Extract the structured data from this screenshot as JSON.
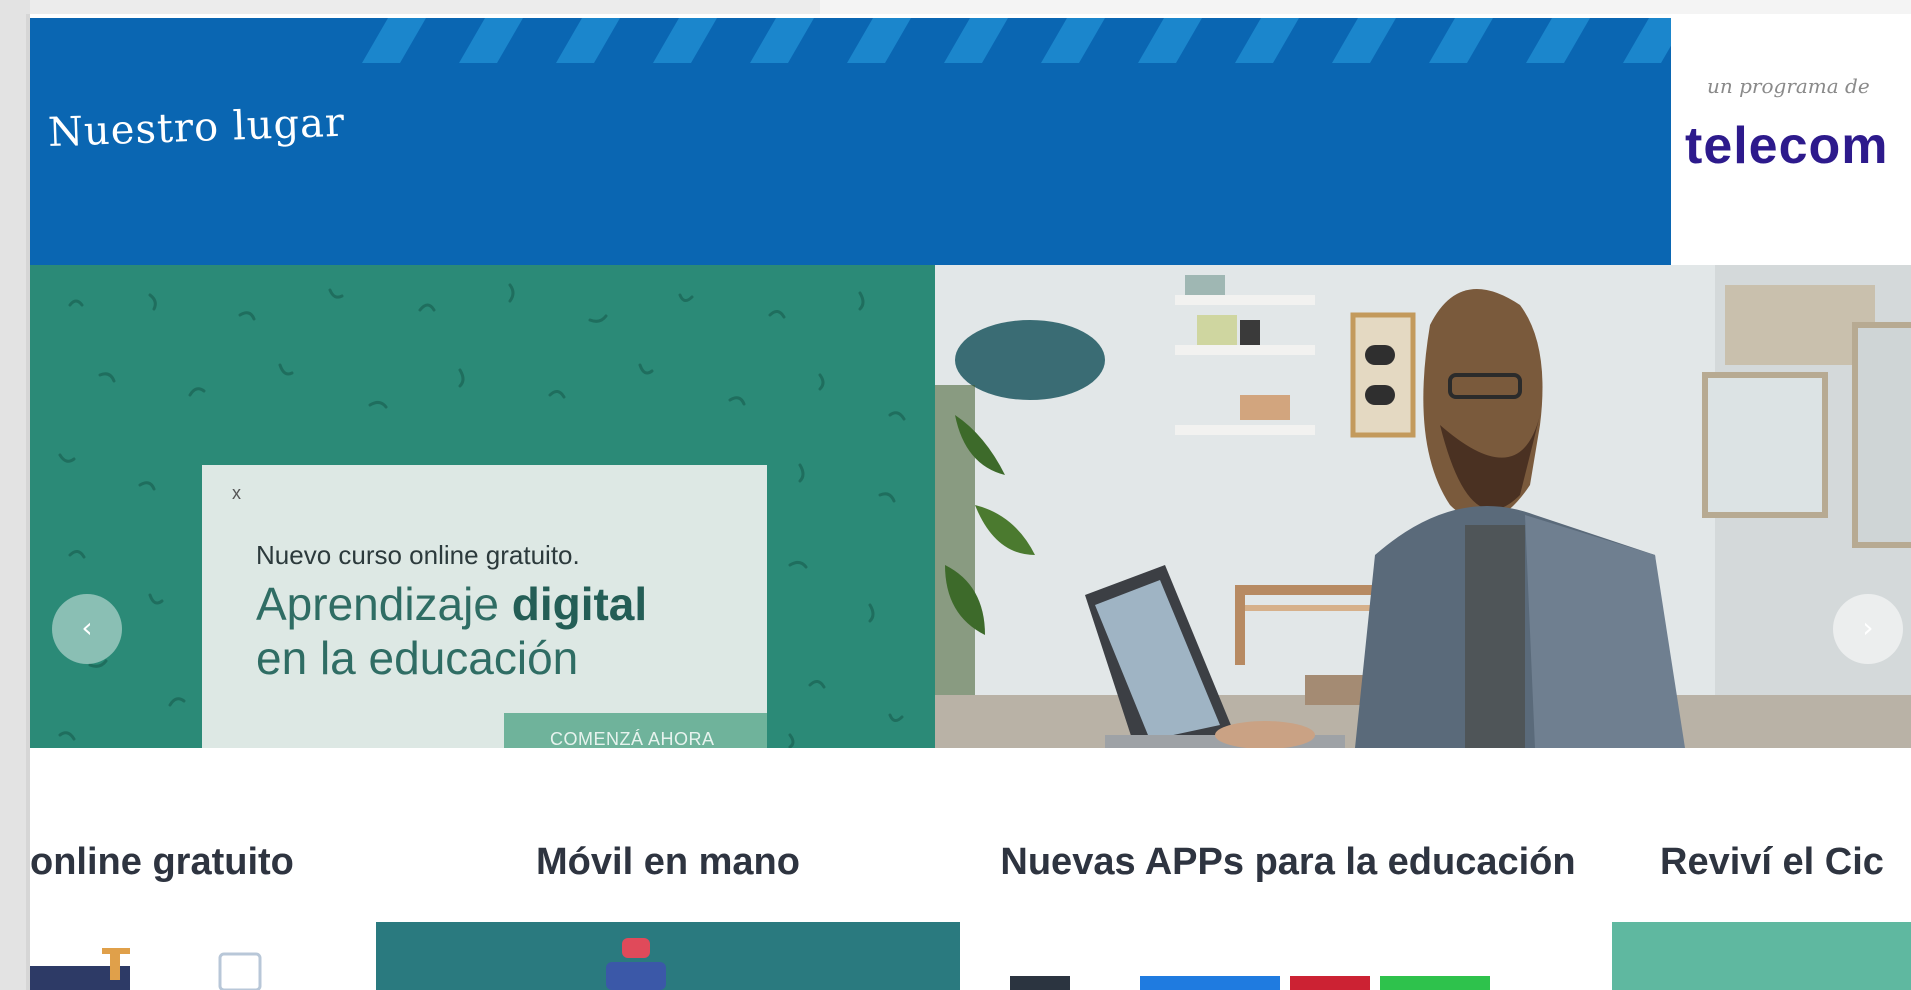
{
  "header": {
    "site_title": "Nuestro lugar",
    "brand_prefix": "un programa de",
    "brand_name": "telecom"
  },
  "carousel": {
    "slides": [
      {
        "close": "x",
        "kicker": "Nuevo curso online gratuito.",
        "title_plain": "Aprendizaje",
        "title_bold": "digital",
        "title_line2": "en la educación",
        "cta": "COMENZÁ AHORA"
      }
    ],
    "prev_icon": "‹",
    "next_icon": "›"
  },
  "cards": [
    {
      "title": "online gratuito"
    },
    {
      "title": "Móvil en mano"
    },
    {
      "title": "Nuevas APPs para la educación"
    },
    {
      "title": "Reviví el Cic"
    }
  ],
  "colors": {
    "header_blue": "#0a66b2",
    "stripe_blue": "#1b86cc",
    "brand_purple": "#2d1a8c",
    "slide_green": "#2b8a77"
  }
}
